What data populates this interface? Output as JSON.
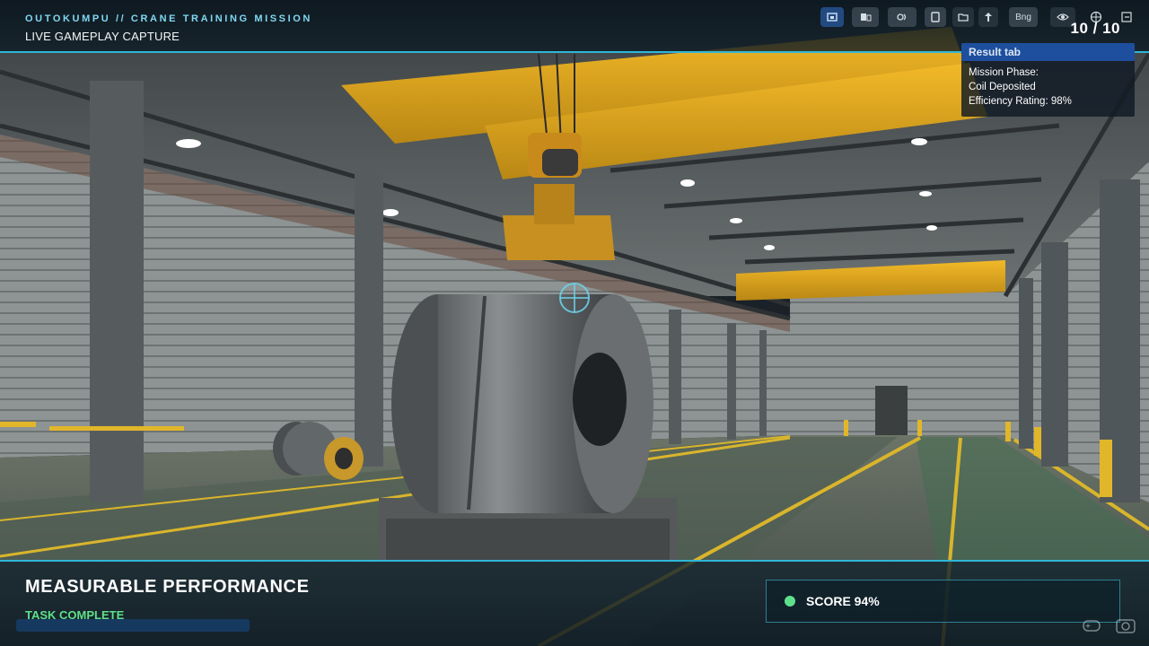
{
  "hud": {
    "mission_title": "OUTOKUMPU // CRANE TRAINING MISSION",
    "capture_label": "LIVE GAMEPLAY CAPTURE",
    "page_counter": "10 / 10",
    "accent_color": "#2fb7d6"
  },
  "toolbar": {
    "buttons": [
      {
        "name": "cast-icon"
      },
      {
        "name": "layers-icon"
      },
      {
        "name": "audio-icon"
      },
      {
        "name": "copy-icon"
      },
      {
        "name": "folder-icon"
      },
      {
        "name": "upload-icon"
      },
      {
        "name": "text-badge",
        "label": "Bng"
      },
      {
        "name": "eye-icon"
      },
      {
        "name": "globe-icon"
      },
      {
        "name": "exit-icon"
      }
    ]
  },
  "result_panel": {
    "tab_label": "Result tab",
    "lines": [
      "Mission Phase:",
      "Coil Deposited",
      "Efficiency Rating: 98%"
    ]
  },
  "bottom": {
    "title": "MEASURABLE PERFORMANCE",
    "status": "TASK COMPLETE",
    "status_color": "#5fe08a",
    "score_label": "SCORE 94%"
  }
}
